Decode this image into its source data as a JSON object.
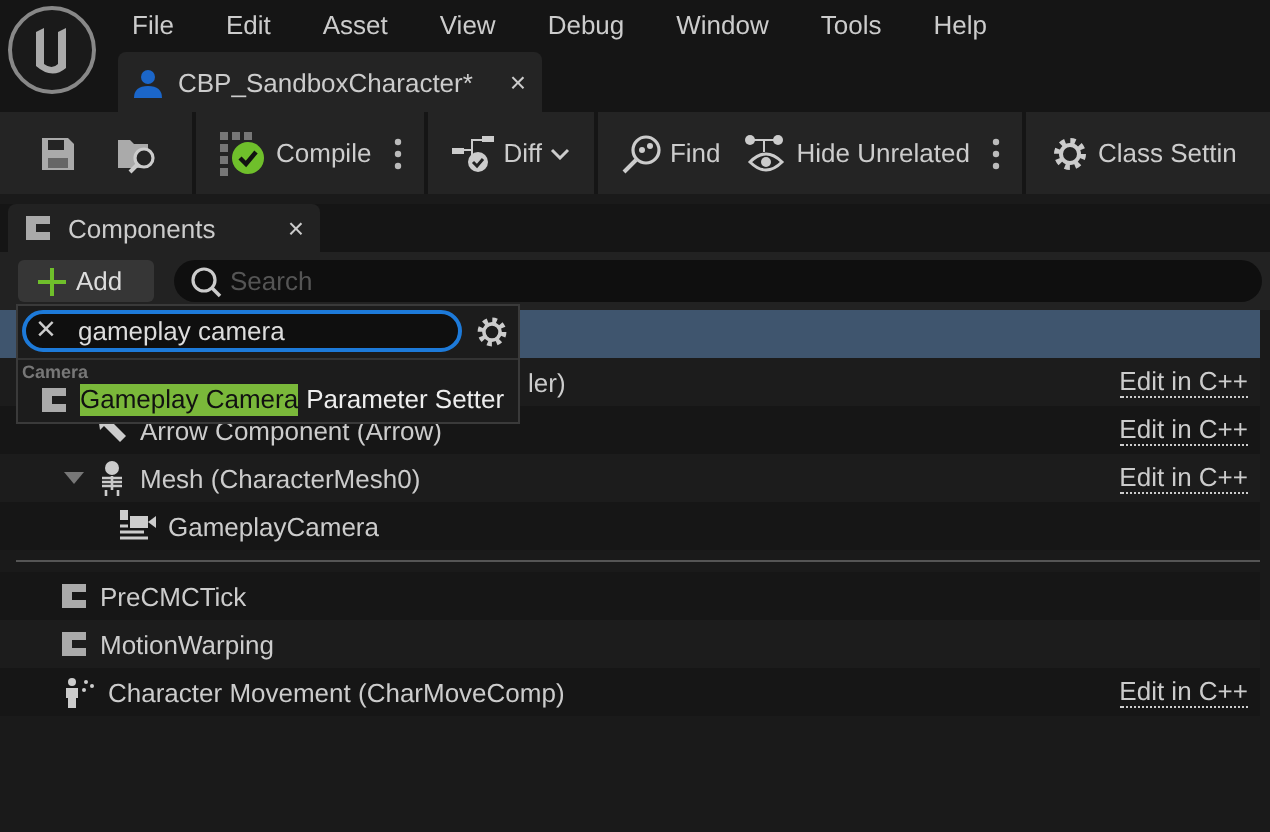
{
  "menu": [
    "File",
    "Edit",
    "Asset",
    "View",
    "Debug",
    "Window",
    "Tools",
    "Help"
  ],
  "document_tab": {
    "title": "CBP_SandboxCharacter*",
    "close": "×"
  },
  "toolbar": [
    {
      "kind": "save"
    },
    {
      "kind": "browse"
    },
    {
      "kind": "sep"
    },
    {
      "kind": "compile",
      "label": "Compile"
    },
    {
      "kind": "more"
    },
    {
      "kind": "sep"
    },
    {
      "kind": "diff",
      "label": "Diff"
    },
    {
      "kind": "sep"
    },
    {
      "kind": "find",
      "label": "Find"
    },
    {
      "kind": "hide",
      "label": "Hide Unrelated"
    },
    {
      "kind": "more"
    },
    {
      "kind": "sep"
    },
    {
      "kind": "settings",
      "label": "Class Settin"
    }
  ],
  "panel": {
    "title": "Components",
    "close": "×",
    "add_button": "Add",
    "search": {
      "placeholder": "Search"
    }
  },
  "tree": [
    {
      "selected": true,
      "children": [
        {
          "label": "ler)",
          "kind": "covered",
          "link": "Edit in C++",
          "children": [
            {
              "label": "Arrow Component (Arrow)",
              "kind": "arrow",
              "link": "Edit in C++"
            },
            {
              "label": "Mesh (CharacterMesh0)",
              "kind": "mesh",
              "link": "Edit in C++",
              "expanded": true,
              "children": [
                {
                  "label": "GameplayCamera",
                  "kind": "camera"
                }
              ]
            }
          ]
        }
      ]
    }
  ],
  "components": [
    {
      "label": "PreCMCTick",
      "kind": "class"
    },
    {
      "label": "MotionWarping",
      "kind": "class"
    },
    {
      "label": "Character Movement (CharMoveComp)",
      "kind": "movement",
      "link": "Edit in C++"
    }
  ],
  "add_popup": {
    "search_value": "gameplay camera",
    "clear": "×",
    "category": "Camera",
    "results": [
      {
        "match": "Gameplay Camera",
        "rest": "Parameter Setter"
      }
    ]
  }
}
